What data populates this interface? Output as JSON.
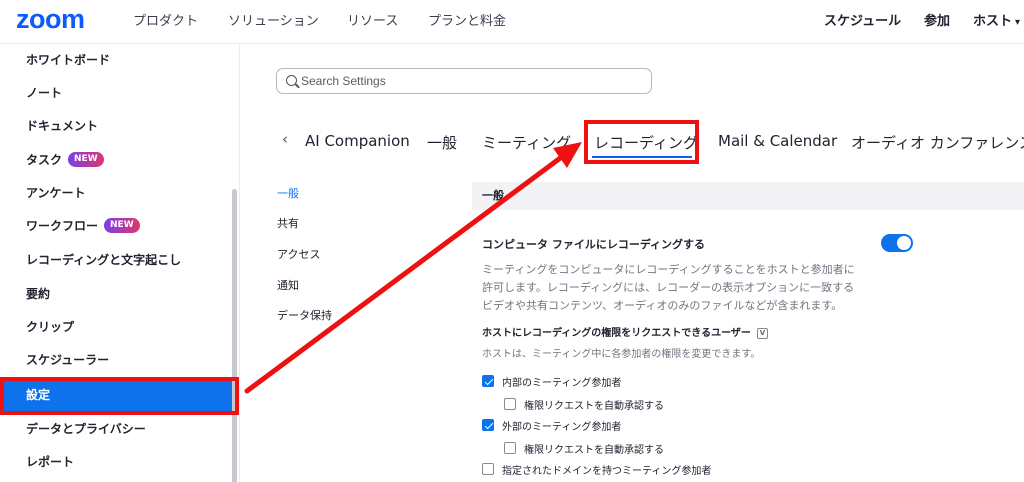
{
  "header": {
    "logo": "zoom",
    "nav": [
      "プロダクト",
      "ソリューション",
      "リソース",
      "プランと料金"
    ],
    "right": {
      "schedule": "スケジュール",
      "join": "参加",
      "host": "ホスト"
    }
  },
  "sidebar": {
    "items": [
      {
        "label": "ホワイトボード"
      },
      {
        "label": "ノート"
      },
      {
        "label": "ドキュメント"
      },
      {
        "label": "タスク",
        "badge": "NEW"
      },
      {
        "label": "アンケート"
      },
      {
        "label": "ワークフロー",
        "badge": "NEW"
      },
      {
        "label": "レコーディングと文字起こし"
      },
      {
        "label": "要約"
      },
      {
        "label": "クリップ"
      },
      {
        "label": "スケジューラー"
      },
      {
        "label": "設定",
        "active": true
      },
      {
        "label": "データとプライバシー"
      },
      {
        "label": "レポート"
      }
    ]
  },
  "search": {
    "placeholder": "Search Settings"
  },
  "tabs": [
    "AI Companion",
    "一般",
    "ミーティング",
    "レコーディング",
    "Mail & Calendar",
    "オーディオ カンファレンス"
  ],
  "active_tab": "レコーディング",
  "subnav": [
    "一般",
    "共有",
    "アクセス",
    "通知",
    "データ保持"
  ],
  "content": {
    "section_header": "一般",
    "setting": {
      "title": "コンピュータ ファイルにレコーディングする",
      "toggle_on": true,
      "description": [
        "ミーティングをコンピュータにレコーディングすることをホストと参加者に",
        "許可します。レコーディングには、レコーダーの表示オプションに一致する",
        "ビデオや共有コンテンツ、オーディオのみのファイルなどが含まれます。"
      ]
    },
    "permission": {
      "title": "ホストにレコーディングの権限をリクエストできるユーザー",
      "info_icon": "V",
      "description": "ホストは、ミーティング中に各参加者の権限を変更できます。",
      "options": [
        {
          "label": "内部のミーティング参加者",
          "checked": true,
          "indent": false
        },
        {
          "label": "権限リクエストを自動承認する",
          "checked": false,
          "indent": true
        },
        {
          "label": "外部のミーティング参加者",
          "checked": true,
          "indent": false
        },
        {
          "label": "権限リクエストを自動承認する",
          "checked": false,
          "indent": true
        },
        {
          "label": "指定されたドメインを持つミーティング参加者",
          "checked": false,
          "indent": false
        }
      ]
    }
  },
  "colors": {
    "accent": "#0e72ed",
    "brand": "#0b5cff",
    "highlight": "#ee1111"
  }
}
